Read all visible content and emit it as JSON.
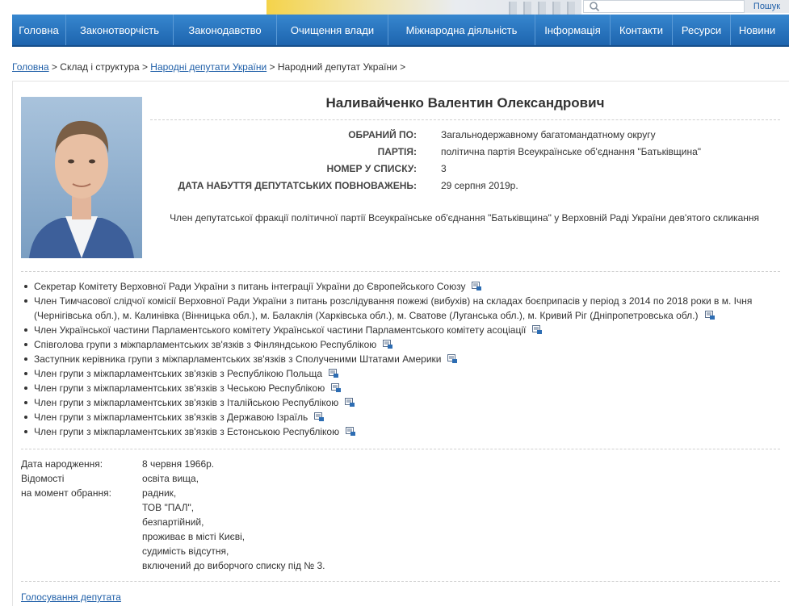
{
  "search": {
    "button_label": "Пошук",
    "icon": "search-icon"
  },
  "nav": {
    "items": [
      {
        "label": "Головна"
      },
      {
        "label": "Законотворчість"
      },
      {
        "label": "Законодавство"
      },
      {
        "label": "Очищення влади"
      },
      {
        "label": "Міжнародна діяльність"
      },
      {
        "label": "Інформація"
      },
      {
        "label": "Контакти"
      },
      {
        "label": "Ресурси"
      },
      {
        "label": "Новини"
      }
    ]
  },
  "breadcrumb": {
    "home": "Головна",
    "sep": " > ",
    "structure": "Склад і структура",
    "deputies": "Народні депутати України",
    "current": "Народний депутат України",
    "tail": " >"
  },
  "deputy": {
    "name": "Наливайченко Валентин Олександрович",
    "info": [
      {
        "label": "ОБРАНИЙ ПО:",
        "value": "Загальнодержавному багатомандатному округу"
      },
      {
        "label": "ПАРТІЯ:",
        "value": "політична партія Всеукраїнське об'єднання \"Батьківщина\""
      },
      {
        "label": "НОМЕР У СПИСКУ:",
        "value": "3"
      },
      {
        "label": "ДАТА НАБУТТЯ ДЕПУТАТСЬКИХ ПОВНОВАЖЕНЬ:",
        "value": "29 серпня 2019р."
      }
    ],
    "faction": "Член депутатської фракції політичної партії Всеукраїнське об'єднання \"Батьківщина\" у Верховній Раді України дев'ятого скликання"
  },
  "posts": [
    {
      "text": "Секретар Комітету Верховної Ради України з питань інтеграції України до Європейського Союзу"
    },
    {
      "text": "Член Тимчасової слідчої комісії Верховної Ради України з питань розслідування пожежі (вибухів) на складах боєприпасів у період з 2014 по 2018 роки в м. Ічня (Чернігівська обл.), м. Калинівка (Вінницька обл.), м. Балаклія (Харківська обл.), м. Сватове (Луганська обл.), м. Кривий Ріг (Дніпропетровська обл.)"
    },
    {
      "text": "Член Української частини Парламентського комітету Української частини Парламентського комітету асоціації"
    },
    {
      "text": "Співголова групи з міжпарламентських зв'язків з Фінляндською Республікою"
    },
    {
      "text": "Заступник керівника групи з міжпарламентських зв'язків з Сполученими Штатами Америки"
    },
    {
      "text": "Член групи з міжпарламентських зв'язків з Республікою Польща"
    },
    {
      "text": "Член групи з міжпарламентських зв'язків з Чеською Республікою"
    },
    {
      "text": "Член групи з міжпарламентських зв'язків з Італійською Республікою"
    },
    {
      "text": "Член групи з міжпарламентських зв'язків з Державою Ізраїль"
    },
    {
      "text": "Член групи з міжпарламентських зв'язків з Естонською Республікою"
    }
  ],
  "bio": {
    "birth_label": "Дата народження:",
    "birth_value": "8 червня 1966р.",
    "info_label_1": "Відомості",
    "info_label_2": "на момент обрання:",
    "lines": [
      "освіта вища,",
      "радник,",
      "ТОВ \"ПАЛ\",",
      "безпартійний,",
      "проживає в місті Києві,",
      "судимість відсутня,",
      "включений до виборчого списку під № 3."
    ]
  },
  "links": {
    "voting": "Голосування депутата"
  },
  "colors": {
    "nav_top": "#3787cf",
    "nav_bottom": "#1d64ae",
    "link": "#1f5fa8"
  }
}
